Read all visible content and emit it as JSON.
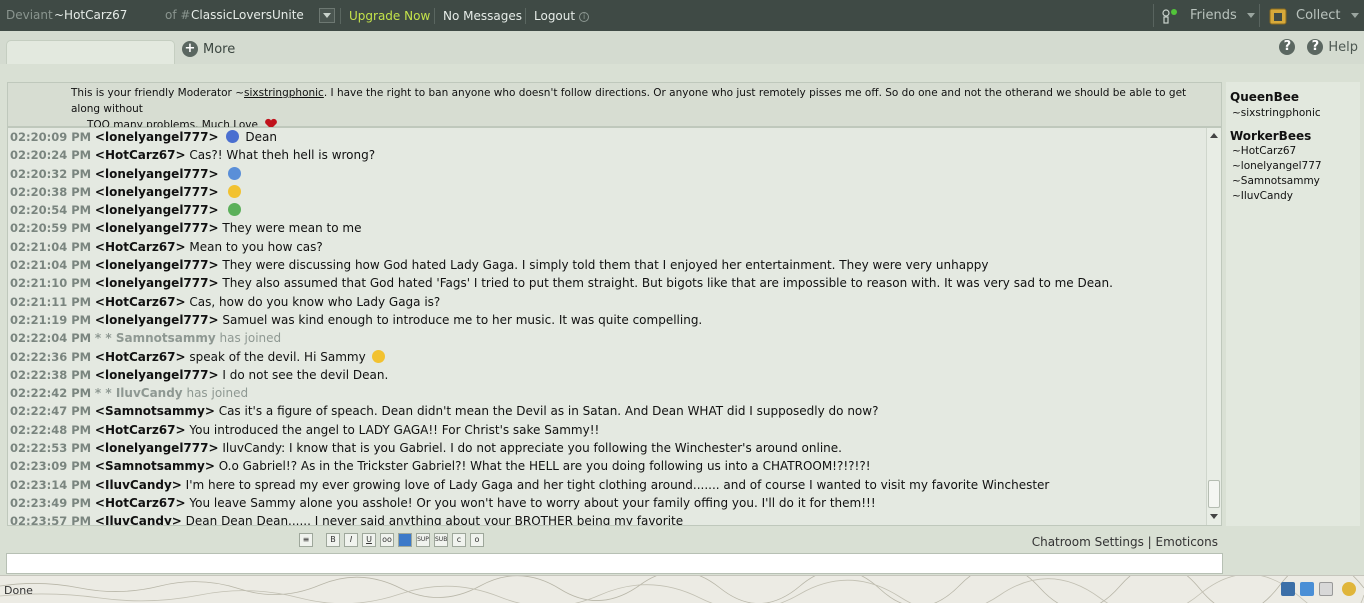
{
  "topbar": {
    "deviant_label": "Deviant",
    "deviant_name": "~HotCarz67",
    "of_label": "of #",
    "room": "ClassicLoversUnite",
    "upgrade": "Upgrade Now",
    "messages": "No Messages",
    "logout": "Logout",
    "friends": "Friends",
    "collect": "Collect"
  },
  "bar2": {
    "more": "More",
    "help": "Help"
  },
  "announcement": {
    "part1": "This is your friendly Moderator ~",
    "moderator": "sixstringphonic",
    "part2": ". I have the right to ban anyone who doesn't follow directions. Or anyone who just remotely pisses me off. So do one and not the otherand we should be able to get along without",
    "line2": "TOO many problems. Much Love"
  },
  "chat": [
    {
      "ts": "02:20:09 PM",
      "nick": "<lonelyangel777>",
      "msg": "Dean",
      "emo": "#4a6fd0"
    },
    {
      "ts": "02:20:24 PM",
      "nick": "<HotCarz67>",
      "msg": "Cas?! What theh hell is wrong?"
    },
    {
      "ts": "02:20:32 PM",
      "nick": "<lonelyangel777>",
      "msg": "",
      "emo": "#5a8fd8"
    },
    {
      "ts": "02:20:38 PM",
      "nick": "<lonelyangel777>",
      "msg": "",
      "emo": "#f2c230"
    },
    {
      "ts": "02:20:54 PM",
      "nick": "<lonelyangel777>",
      "msg": "",
      "emo": "#5bb05a"
    },
    {
      "ts": "02:20:59 PM",
      "nick": "<lonelyangel777>",
      "msg": "They were mean to me"
    },
    {
      "ts": "02:21:04 PM",
      "nick": "<HotCarz67>",
      "msg": "Mean to you how cas?"
    },
    {
      "ts": "02:21:04 PM",
      "nick": "<lonelyangel777>",
      "msg": "They were discussing how God hated Lady Gaga. I simply told them that I enjoyed her entertainment. They were very unhappy"
    },
    {
      "ts": "02:21:10 PM",
      "nick": "<lonelyangel777>",
      "msg": "They also assumed that God hated 'Fags' I tried to put them straight. But bigots like that are impossible to reason with. It was very sad to me Dean."
    },
    {
      "ts": "02:21:11 PM",
      "nick": "<HotCarz67>",
      "msg": "Cas, how do you know who Lady Gaga is?"
    },
    {
      "ts": "02:21:19 PM",
      "nick": "<lonelyangel777>",
      "msg": "Samuel was kind enough to introduce me to her music. It was quite compelling."
    },
    {
      "ts": "02:22:04 PM",
      "join": "* * Samnotsammy",
      "joinrest": "has joined"
    },
    {
      "ts": "02:22:36 PM",
      "nick": "<HotCarz67>",
      "msg": "speak of the devil. Hi Sammy",
      "emo": "#f2c230"
    },
    {
      "ts": "02:22:38 PM",
      "nick": "<lonelyangel777>",
      "msg": "I do not see the devil Dean."
    },
    {
      "ts": "02:22:42 PM",
      "join": "* * IluvCandy",
      "joinrest": "has joined"
    },
    {
      "ts": "02:22:47 PM",
      "nick": "<Samnotsammy>",
      "msg": "Cas it's a figure of speach. Dean didn't mean the Devil as in Satan. And Dean WHAT did I supposedly do now?"
    },
    {
      "ts": "02:22:48 PM",
      "nick": "<HotCarz67>",
      "msg": "You introduced the angel to LADY GAGA!! For Christ's sake Sammy!!"
    },
    {
      "ts": "02:22:53 PM",
      "nick": "<lonelyangel777>",
      "msg": "IluvCandy: I know that is you Gabriel. I do not appreciate you following the Winchester's around online."
    },
    {
      "ts": "02:23:09 PM",
      "nick": "<Samnotsammy>",
      "msg": "O.o Gabriel!? As in the Trickster Gabriel?! What the HELL are you doing following us into a CHATROOM!?!?!?!"
    },
    {
      "ts": "02:23:14 PM",
      "nick": "<IluvCandy>",
      "msg": "I'm here to spread my ever growing love of Lady Gaga and her tight clothing around....... and of course I wanted to visit my favorite Winchester"
    },
    {
      "ts": "02:23:49 PM",
      "nick": "<HotCarz67>",
      "msg": "You leave Sammy alone you asshole! Or you won't have to worry about your family offing you. I'll do it for them!!!"
    },
    {
      "ts": "02:23:57 PM",
      "nick": "<IluvCandy>",
      "msg": "Dean Dean Dean...... I never said anything about your BROTHER being my favorite"
    }
  ],
  "userlist": {
    "group1": "QueenBee",
    "group1_users": [
      "~sixstringphonic"
    ],
    "group2": "WorkerBees",
    "group2_users": [
      "~HotCarz67",
      "~lonelyangel777",
      "~Samnotsammy",
      "~IluvCandy"
    ]
  },
  "toolbar": {
    "buttons": [
      "B",
      "I",
      "U",
      "oo",
      "",
      "SUP",
      "SUB",
      "c",
      "o"
    ],
    "settings": "Chatroom Settings",
    "sep": "|",
    "emoticons": "Emoticons"
  },
  "status": {
    "text": "Done"
  }
}
